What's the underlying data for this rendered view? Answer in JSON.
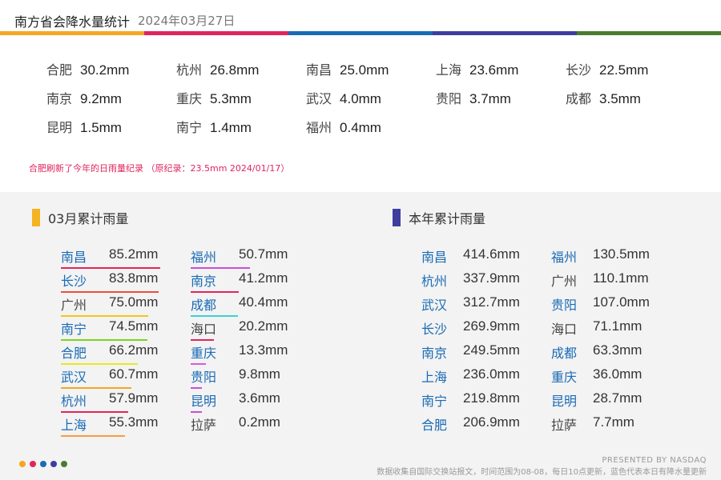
{
  "header": {
    "title": "南方省会降水量统计",
    "date": "2024年03月27日"
  },
  "colors": [
    "#f5a623",
    "#e0245e",
    "#1a6bb5",
    "#3e3e9e",
    "#4a7c2e"
  ],
  "daily": [
    {
      "city": "合肥",
      "value": "30.2mm"
    },
    {
      "city": "杭州",
      "value": "26.8mm"
    },
    {
      "city": "南昌",
      "value": "25.0mm"
    },
    {
      "city": "上海",
      "value": "23.6mm"
    },
    {
      "city": "长沙",
      "value": "22.5mm"
    },
    {
      "city": "南京",
      "value": "9.2mm"
    },
    {
      "city": "重庆",
      "value": "5.3mm"
    },
    {
      "city": "武汉",
      "value": "4.0mm"
    },
    {
      "city": "贵阳",
      "value": "3.7mm"
    },
    {
      "city": "成都",
      "value": "3.5mm"
    },
    {
      "city": "昆明",
      "value": "1.5mm"
    },
    {
      "city": "南宁",
      "value": "1.4mm"
    },
    {
      "city": "福州",
      "value": "0.4mm"
    }
  ],
  "note": "合肥刷新了今年的日雨量纪录 （原纪录：23.5mm 2024/01/17）",
  "monthly": {
    "title": "03月累计雨量",
    "mark_color": "#f5b323",
    "col1": [
      {
        "city": "南昌",
        "value": "85.2mm",
        "highlight": true,
        "line_color": "#e0245e"
      },
      {
        "city": "长沙",
        "value": "83.8mm",
        "highlight": true,
        "line_color": "#e8503a"
      },
      {
        "city": "广州",
        "value": "75.0mm",
        "highlight": false,
        "line_color": "#f5c518"
      },
      {
        "city": "南宁",
        "value": "74.5mm",
        "highlight": true,
        "line_color": "#7ed321"
      },
      {
        "city": "合肥",
        "value": "66.2mm",
        "highlight": true,
        "line_color": "#e8e820"
      },
      {
        "city": "武汉",
        "value": "60.7mm",
        "highlight": true,
        "line_color": "#f5a623"
      },
      {
        "city": "杭州",
        "value": "57.9mm",
        "highlight": true,
        "line_color": "#e0245e"
      },
      {
        "city": "上海",
        "value": "55.3mm",
        "highlight": true,
        "line_color": "#f59e42"
      }
    ],
    "col2": [
      {
        "city": "福州",
        "value": "50.7mm",
        "highlight": true,
        "line_color": "#c94fd8"
      },
      {
        "city": "南京",
        "value": "41.2mm",
        "highlight": true,
        "line_color": "#e0245e"
      },
      {
        "city": "成都",
        "value": "40.4mm",
        "highlight": true,
        "line_color": "#3ad0d8"
      },
      {
        "city": "海口",
        "value": "20.2mm",
        "highlight": false,
        "line_color": "#e0245e"
      },
      {
        "city": "重庆",
        "value": "13.3mm",
        "highlight": true,
        "line_color": "#d85ad8"
      },
      {
        "city": "贵阳",
        "value": "9.8mm",
        "highlight": true,
        "line_color": "#c94fd8"
      },
      {
        "city": "昆明",
        "value": "3.6mm",
        "highlight": true,
        "line_color": "#c94fd8"
      },
      {
        "city": "拉萨",
        "value": "0.2mm",
        "highlight": false,
        "line_color": ""
      }
    ]
  },
  "yearly": {
    "title": "本年累计雨量",
    "mark_color": "#3e3e9e",
    "col1": [
      {
        "city": "南昌",
        "value": "414.6mm",
        "highlight": true
      },
      {
        "city": "杭州",
        "value": "337.9mm",
        "highlight": true
      },
      {
        "city": "武汉",
        "value": "312.7mm",
        "highlight": true
      },
      {
        "city": "长沙",
        "value": "269.9mm",
        "highlight": true
      },
      {
        "city": "南京",
        "value": "249.5mm",
        "highlight": true
      },
      {
        "city": "上海",
        "value": "236.0mm",
        "highlight": true
      },
      {
        "city": "南宁",
        "value": "219.8mm",
        "highlight": true
      },
      {
        "city": "合肥",
        "value": "206.9mm",
        "highlight": true
      }
    ],
    "col2": [
      {
        "city": "福州",
        "value": "130.5mm",
        "highlight": true
      },
      {
        "city": "广州",
        "value": "110.1mm",
        "highlight": false
      },
      {
        "city": "贵阳",
        "value": "107.0mm",
        "highlight": true
      },
      {
        "city": "海口",
        "value": "71.1mm",
        "highlight": false
      },
      {
        "city": "成都",
        "value": "63.3mm",
        "highlight": true
      },
      {
        "city": "重庆",
        "value": "36.0mm",
        "highlight": true
      },
      {
        "city": "昆明",
        "value": "28.7mm",
        "highlight": true
      },
      {
        "city": "拉萨",
        "value": "7.7mm",
        "highlight": false
      }
    ]
  },
  "footer": {
    "presented": "PRESENTED BY NASDAQ",
    "text": "数据收集自国际交换站报文，时间范围为08-08，每日10点更新，蓝色代表本日有降水量更新"
  }
}
